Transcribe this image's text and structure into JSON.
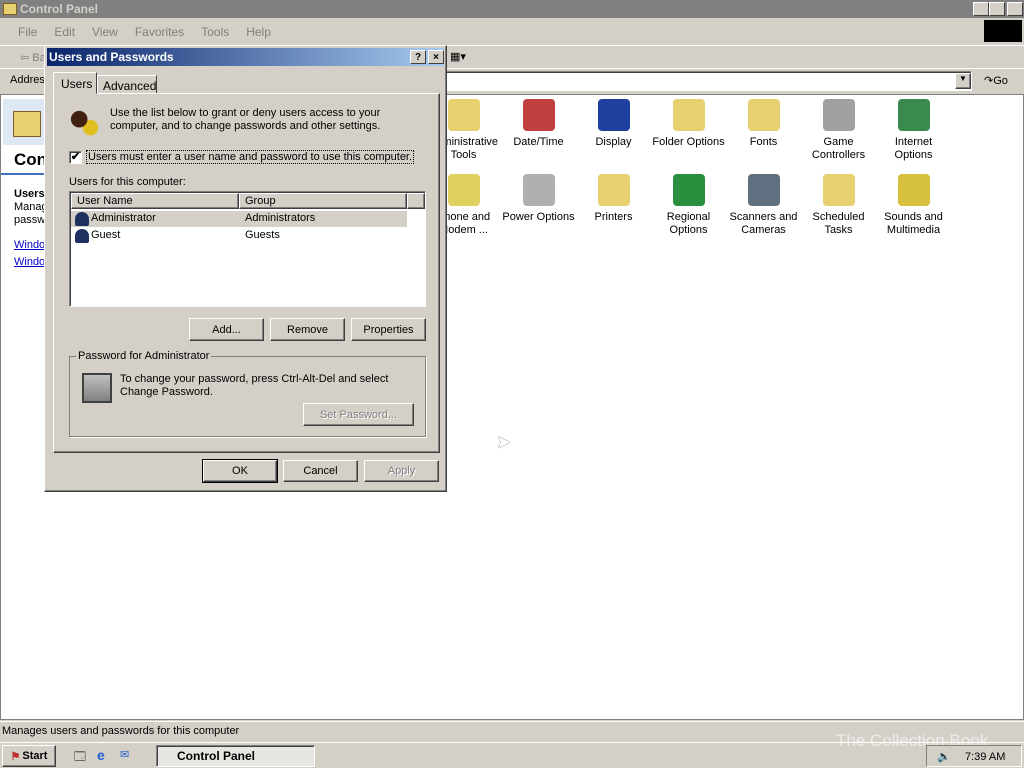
{
  "window": {
    "title": "Control Panel",
    "menu": [
      "File",
      "Edit",
      "View",
      "Favorites",
      "Tools",
      "Help"
    ],
    "back_label": "Back",
    "address_label": "Address",
    "go_label": "Go"
  },
  "left_pane": {
    "title": "Control Panel",
    "item_title": "Users and Passwords",
    "item_desc": "Manages users and passwords for this computer",
    "links": [
      "Windows Update",
      "Windows 2000 Support"
    ]
  },
  "icons": [
    {
      "label": "Administrative Tools",
      "color": "#e8d070"
    },
    {
      "label": "Date/Time",
      "color": "#c04040"
    },
    {
      "label": "Display",
      "color": "#2040a0"
    },
    {
      "label": "Folder Options",
      "color": "#e8d070"
    },
    {
      "label": "Fonts",
      "color": "#e8d070"
    },
    {
      "label": "Game Controllers",
      "color": "#a0a0a0"
    },
    {
      "label": "Internet Options",
      "color": "#3a8a50"
    },
    {
      "label": "Phone and Modem ...",
      "color": "#e0d060"
    },
    {
      "label": "Power Options",
      "color": "#b0b0b0"
    },
    {
      "label": "Printers",
      "color": "#e8d070"
    },
    {
      "label": "Regional Options",
      "color": "#2a9040"
    },
    {
      "label": "Scanners and Cameras",
      "color": "#607080"
    },
    {
      "label": "Scheduled Tasks",
      "color": "#e8d070"
    },
    {
      "label": "Sounds and Multimedia",
      "color": "#d8c040"
    }
  ],
  "status_bar": "Manages users and passwords for this computer",
  "taskbar": {
    "start": "Start",
    "task": "Control Panel",
    "clock": "7:39 AM",
    "watermark": "The Collection Book"
  },
  "dialog": {
    "title": "Users and Passwords",
    "help": "?",
    "close": "×",
    "tabs": [
      "Users",
      "Advanced"
    ],
    "intro": "Use the list below to grant or deny users access to your computer, and to change passwords and other settings.",
    "checkbox_label": "Users must enter a user name and password to use this computer.",
    "checkbox_checked": true,
    "list_label": "Users for this computer:",
    "columns": [
      "User Name",
      "Group"
    ],
    "users": [
      {
        "name": "Administrator",
        "group": "Administrators"
      },
      {
        "name": "Guest",
        "group": "Guests"
      }
    ],
    "add": "Add...",
    "remove": "Remove",
    "properties": "Properties",
    "password_group": "Password for Administrator",
    "password_text": "To change your password, press Ctrl-Alt-Del and select Change Password.",
    "set_password": "Set Password...",
    "ok": "OK",
    "cancel": "Cancel",
    "apply": "Apply"
  }
}
